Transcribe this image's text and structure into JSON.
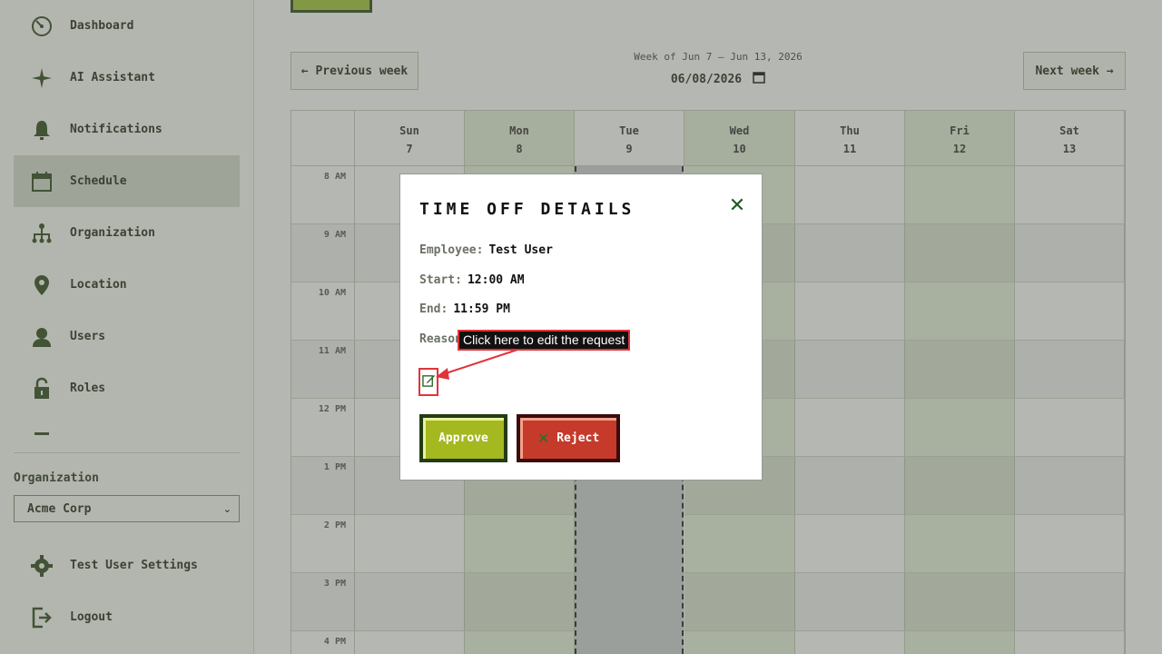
{
  "sidebar": {
    "items": [
      {
        "label": "Dashboard",
        "icon": "dashboard-icon"
      },
      {
        "label": "AI Assistant",
        "icon": "sparkle-icon"
      },
      {
        "label": "Notifications",
        "icon": "bell-icon"
      },
      {
        "label": "Schedule",
        "icon": "calendar-icon",
        "active": true
      },
      {
        "label": "Organization",
        "icon": "org-chart-icon"
      },
      {
        "label": "Location",
        "icon": "location-pin-icon"
      },
      {
        "label": "Users",
        "icon": "user-icon"
      },
      {
        "label": "Roles",
        "icon": "lock-icon"
      }
    ],
    "org_label": "Organization",
    "org_selected": "Acme Corp",
    "settings_label": "Test User Settings",
    "logout_label": "Logout"
  },
  "schedule": {
    "prev_week": "← Previous week",
    "next_week": "Next week →",
    "week_label": "Week of Jun 7 – Jun 13, 2026",
    "date_value": "06/08/2026",
    "days": [
      {
        "name": "Sun",
        "num": "7"
      },
      {
        "name": "Mon",
        "num": "8"
      },
      {
        "name": "Tue",
        "num": "9"
      },
      {
        "name": "Wed",
        "num": "10"
      },
      {
        "name": "Thu",
        "num": "11"
      },
      {
        "name": "Fri",
        "num": "12"
      },
      {
        "name": "Sat",
        "num": "13"
      }
    ],
    "hours": [
      "8 AM",
      "9 AM",
      "10 AM",
      "11 AM",
      "12 PM",
      "1 PM",
      "2 PM",
      "3 PM",
      "4 PM"
    ]
  },
  "modal": {
    "title": "TIME OFF DETAILS",
    "employee_label": "Employee:",
    "employee_value": "Test User",
    "start_label": "Start:",
    "start_value": "12:00 AM",
    "end_label": "End:",
    "end_value": "11:59 PM",
    "reason_label": "Reason:",
    "approve_label": "Approve",
    "reject_label": "Reject"
  },
  "annotation": {
    "text": "Click here to edit the request"
  },
  "colors": {
    "accent_green": "#a4b820",
    "reject_red": "#c53a2a",
    "dark_green": "#243c14",
    "annotation_red": "#e0343a"
  }
}
